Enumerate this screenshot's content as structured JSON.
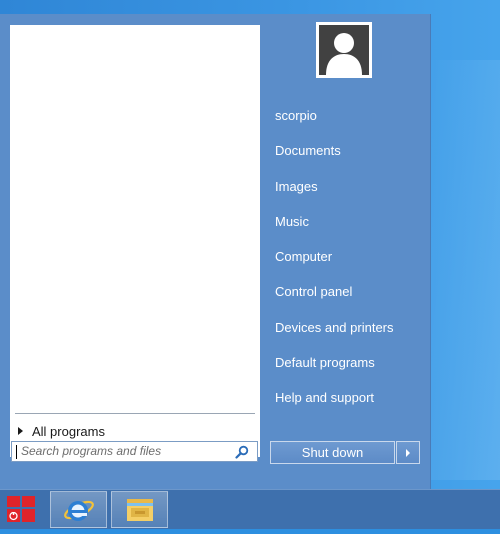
{
  "start_menu": {
    "all_programs_label": "All programs",
    "search": {
      "placeholder": "Search programs and files"
    },
    "user": {
      "name": "scorpio"
    },
    "right_items": [
      "Documents",
      "Images",
      "Music",
      "Computer",
      "Control panel",
      "Devices and printers",
      "Default programs",
      "Help and support"
    ],
    "shutdown_label": "Shut down"
  },
  "taskbar": {
    "items": [
      {
        "icon": "internet-explorer-icon"
      },
      {
        "icon": "file-explorer-icon"
      }
    ]
  },
  "colors": {
    "start_menu_bg": "#5b8dc9",
    "taskbar_bg": "#3e70ad",
    "start_button_red": "#e0242a"
  }
}
